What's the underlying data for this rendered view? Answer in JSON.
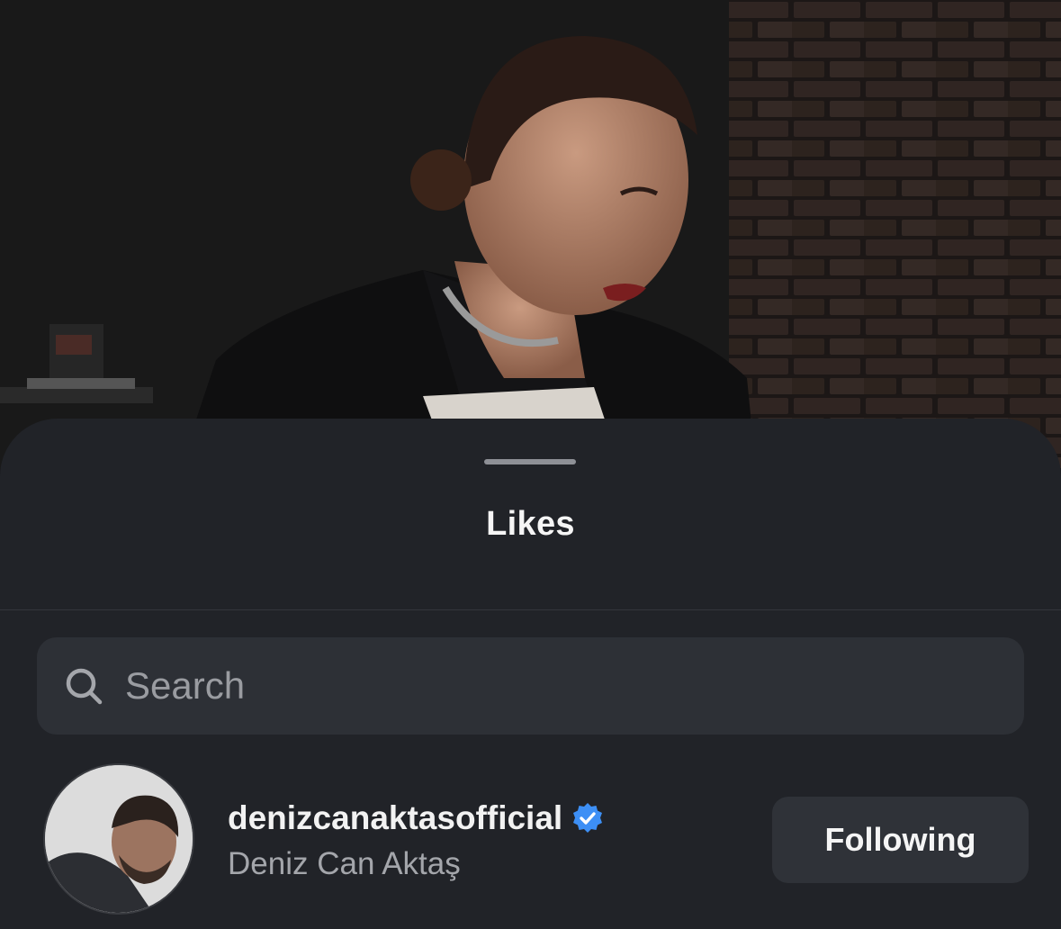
{
  "post": {
    "image_icon": "post-photo"
  },
  "sheet": {
    "title": "Likes"
  },
  "search": {
    "placeholder": "Search",
    "value": "",
    "icon": "search-icon"
  },
  "likes": [
    {
      "username": "denizcanaktasofficial",
      "full_name": "Deniz Can Aktaş",
      "verified": true,
      "button_label": "Following"
    }
  ],
  "colors": {
    "sheet_background": "#212328",
    "search_background": "#2d3036",
    "verified_badge": "#3d8ff5",
    "button_background": "#2f3238"
  }
}
